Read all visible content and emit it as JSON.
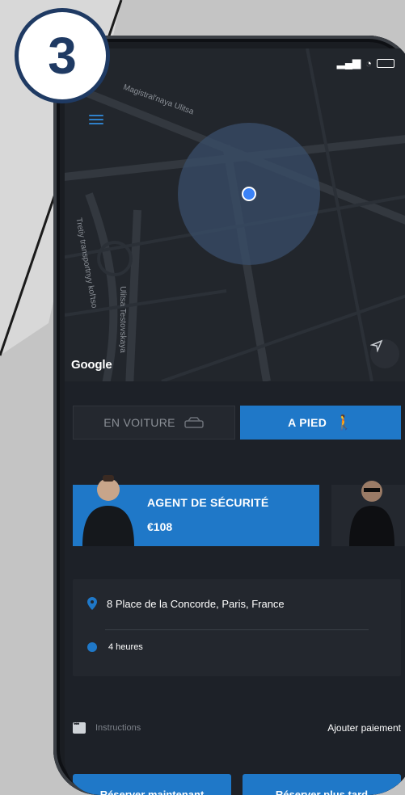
{
  "step_badge": {
    "number": "3"
  },
  "map": {
    "google_label": "Google",
    "street_labels": [
      "Magistral'naya Ulitsa",
      "Tretiy transportnyy kol'tso",
      "Ulitsa Testovskaya"
    ]
  },
  "mode_toggle": {
    "car_label": "EN VOITURE",
    "walk_label": "A PIED",
    "selected": "walk"
  },
  "agent": {
    "title": "AGENT DE SÉCURITÉ",
    "price": "€108"
  },
  "booking": {
    "address": "8 Place de la Concorde, Paris, France",
    "duration": "4 heures"
  },
  "instructions": {
    "label": "Instructions",
    "payment_label": "Ajouter paiement"
  },
  "actions": {
    "book_now": "Réserver maintenant",
    "book_later": "Réserver plus tard"
  },
  "colors": {
    "accent": "#1f78c8",
    "badge": "#1f3a63",
    "background": "#c4c4c4"
  }
}
